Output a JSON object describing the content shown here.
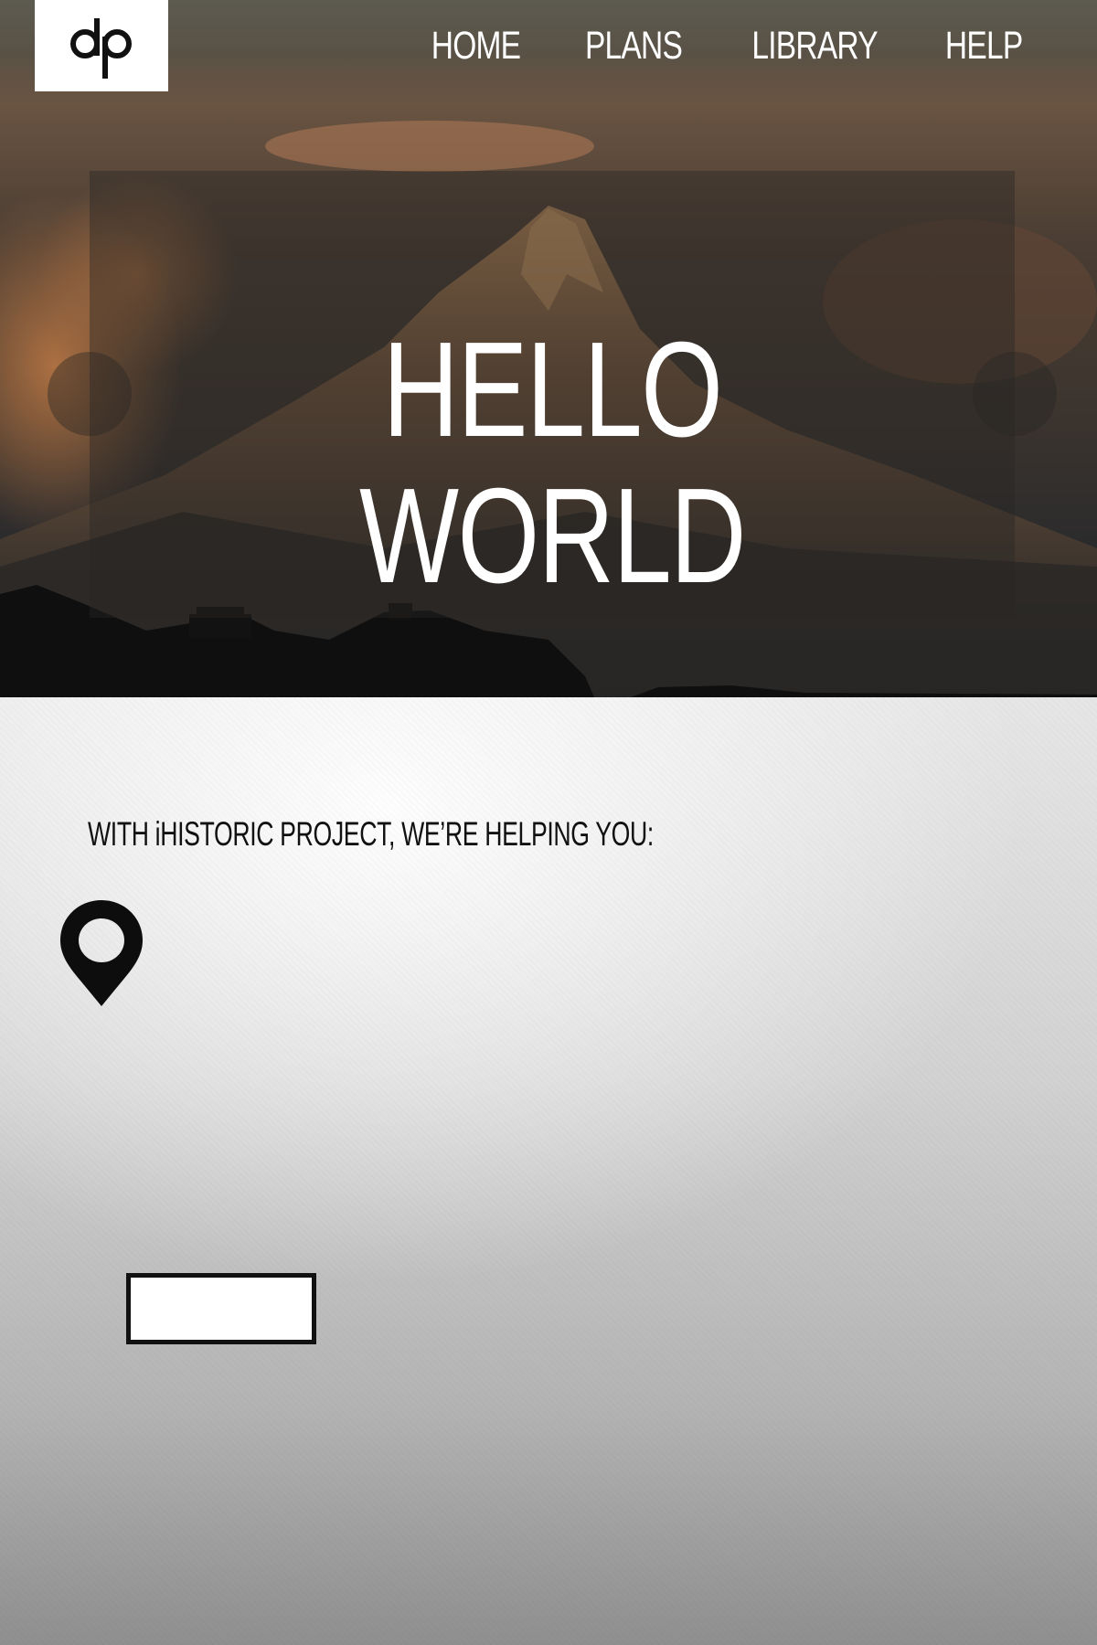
{
  "header": {
    "logo_text": "dp",
    "logo_icon": "dp-monogram-logo",
    "nav": [
      {
        "label": "HOME"
      },
      {
        "label": "PLANS"
      },
      {
        "label": "LIBRARY"
      },
      {
        "label": "HELP"
      }
    ]
  },
  "hero": {
    "title": "HELLO WORLD",
    "background": "mountain-sunset-photo"
  },
  "main": {
    "tagline": "WITH iHISTORIC PROJECT, WE’RE HELPING YOU:",
    "location_icon": "map-pin-icon",
    "button_label": ""
  },
  "colors": {
    "nav_text": "#ffffff",
    "tagline_text": "#111111",
    "button_border": "#111111",
    "button_fill": "#ffffff"
  }
}
